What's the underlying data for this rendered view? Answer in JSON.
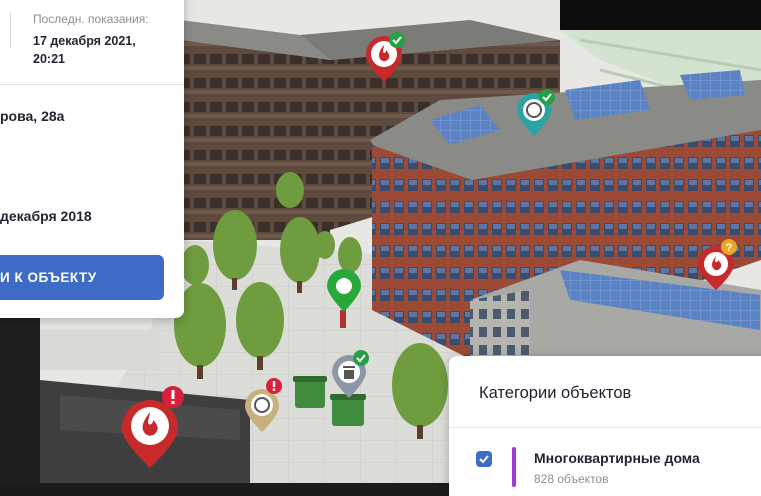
{
  "info_panel": {
    "last_reading_label": "Последн. показания:",
    "last_reading_date_line1": "17 декабря 2021,",
    "last_reading_date_line2": "20:21",
    "address_partial": "рова, 28а",
    "date_partial": "декабря 2018",
    "go_button_label": "И К ОБЪЕКТУ"
  },
  "categories_panel": {
    "title": "Категории объектов",
    "items": [
      {
        "name": "Многоквартирные дома",
        "count": "828 объектов",
        "checked": true,
        "color": "#9b3bd6"
      }
    ]
  },
  "map_markers": [
    {
      "icon": "fire-icon",
      "status": "ok"
    },
    {
      "icon": "manhole-icon",
      "status": "ok"
    },
    {
      "icon": "fire-icon",
      "status": "warning"
    },
    {
      "icon": "location-icon",
      "status": "selected"
    },
    {
      "icon": "fire-icon",
      "status": "alert"
    },
    {
      "icon": "manhole-icon",
      "status": "alert"
    },
    {
      "icon": "trash-icon",
      "status": "ok"
    }
  ],
  "colors": {
    "accent": "#3e6bc6",
    "fire_pin": "#c62a2a",
    "ok_badge": "#25a046",
    "alert_badge": "#d8203a",
    "warning_badge": "#f1a623",
    "teal_pin": "#2aa3a3",
    "green_pin": "#27a839",
    "tan_pin": "#c8b07c",
    "gray_pin": "#8d98a6",
    "category_bar": "#9b3bd6"
  }
}
